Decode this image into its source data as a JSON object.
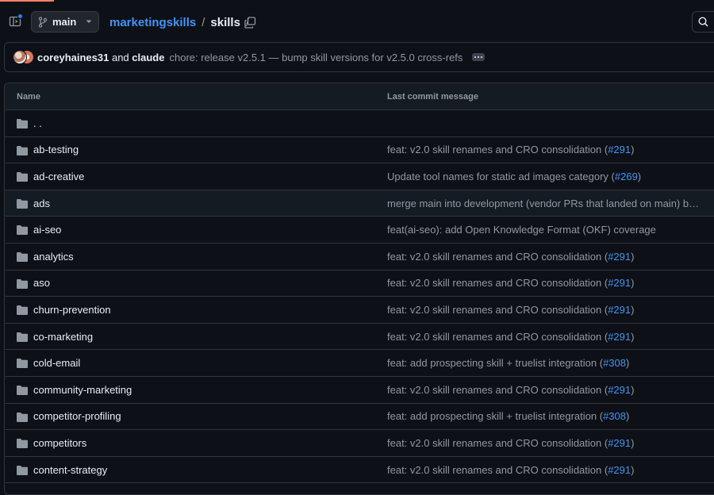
{
  "header": {
    "branch": "main",
    "breadcrumb": {
      "repo": "marketingskills",
      "sep1": "/",
      "current": "skills",
      "sep2": "/"
    }
  },
  "commit": {
    "author1": "coreyhaines31",
    "and": "and",
    "author2": "claude",
    "message": "chore: release v2.5.1 — bump skill versions for v2.5.0 cross-refs"
  },
  "table": {
    "col_name": "Name",
    "col_msg": "Last commit message",
    "parent": ". .",
    "rows": [
      {
        "name": "ab-testing",
        "msg": "feat: v2.0 skill renames and CRO consolidation (",
        "pr": "#291",
        "end": ")"
      },
      {
        "name": "ad-creative",
        "msg": "Update tool names for static ad images category (",
        "pr": "#269",
        "end": ")"
      },
      {
        "name": "ads",
        "msg": "merge main into development (vendor PRs that landed on main) before v…",
        "pr": "",
        "end": ""
      },
      {
        "name": "ai-seo",
        "msg": "feat(ai-seo): add Open Knowledge Format (OKF) coverage",
        "pr": "",
        "end": ""
      },
      {
        "name": "analytics",
        "msg": "feat: v2.0 skill renames and CRO consolidation (",
        "pr": "#291",
        "end": ")"
      },
      {
        "name": "aso",
        "msg": "feat: v2.0 skill renames and CRO consolidation (",
        "pr": "#291",
        "end": ")"
      },
      {
        "name": "churn-prevention",
        "msg": "feat: v2.0 skill renames and CRO consolidation (",
        "pr": "#291",
        "end": ")"
      },
      {
        "name": "co-marketing",
        "msg": "feat: v2.0 skill renames and CRO consolidation (",
        "pr": "#291",
        "end": ")"
      },
      {
        "name": "cold-email",
        "msg": "feat: add prospecting skill + truelist integration (",
        "pr": "#308",
        "end": ")"
      },
      {
        "name": "community-marketing",
        "msg": "feat: v2.0 skill renames and CRO consolidation (",
        "pr": "#291",
        "end": ")"
      },
      {
        "name": "competitor-profiling",
        "msg": "feat: add prospecting skill + truelist integration (",
        "pr": "#308",
        "end": ")"
      },
      {
        "name": "competitors",
        "msg": "feat: v2.0 skill renames and CRO consolidation (",
        "pr": "#291",
        "end": ")"
      },
      {
        "name": "content-strategy",
        "msg": "feat: v2.0 skill renames and CRO consolidation (",
        "pr": "#291",
        "end": ")"
      }
    ]
  }
}
